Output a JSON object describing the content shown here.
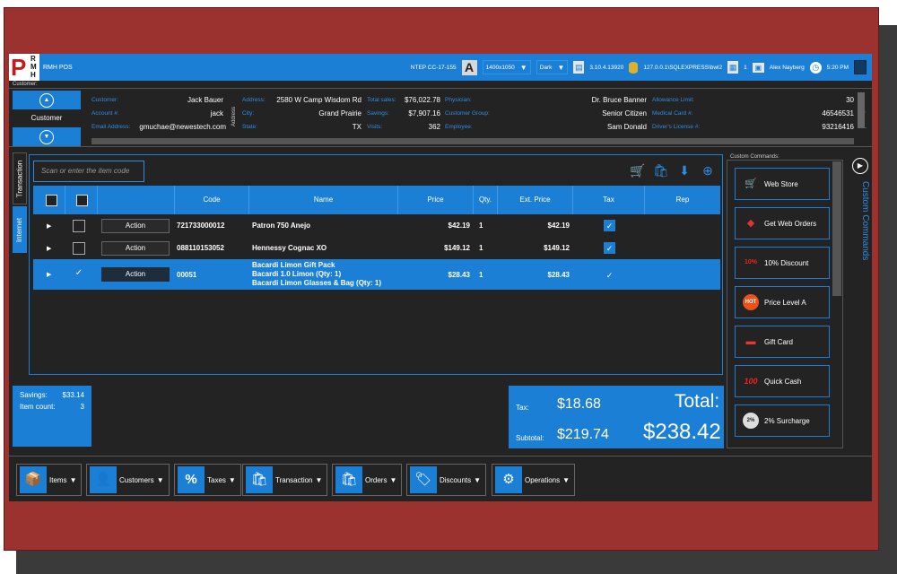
{
  "topbar": {
    "logo_letter": "P",
    "logo_lines": [
      "R",
      "M",
      "H"
    ],
    "app_name": "RMH POS",
    "station": "NTEP CC-17-155",
    "font_icon": "A",
    "resolution": "1400x1050",
    "theme": "Dark",
    "version": "3.10.4.13920",
    "server": "127.0.0.1\\SQLEXPRESS\\bwl2",
    "count": "1",
    "user": "Alex Nayberg",
    "time": "5:20 PM",
    "accent": "#1c7fd6"
  },
  "customer": {
    "section_label": "Customer:",
    "nav_label": "Customer",
    "address_vertical": "Address",
    "fields": [
      {
        "label": "Customer:",
        "value": "Jack Bauer"
      },
      {
        "label": "Account #:",
        "value": "jack"
      },
      {
        "label": "Email Address:",
        "value": "gmuchae@newestech.com"
      },
      {
        "label": "Address:",
        "value": "2580 W Camp Wisdom Rd"
      },
      {
        "label": "City:",
        "value": "Grand Prairie"
      },
      {
        "label": "State:",
        "value": "TX"
      },
      {
        "label": "Total sales:",
        "value": "$76,022.78"
      },
      {
        "label": "Savings:",
        "value": "$7,907.16"
      },
      {
        "label": "Visits:",
        "value": "362"
      },
      {
        "label": "Physician:",
        "value": "Dr. Bruce Banner"
      },
      {
        "label": "Customer Group:",
        "value": "Senior Citizen"
      },
      {
        "label": "Employee:",
        "value": "Sam Donald"
      },
      {
        "label": "Allowance Limit:",
        "value": "30"
      },
      {
        "label": "Medical Card #:",
        "value": "46546531"
      },
      {
        "label": "Driver's License #:",
        "value": "93216416"
      }
    ],
    "cut_labels": [
      "M",
      "Or",
      "DL"
    ]
  },
  "tabs": {
    "transaction": "Transaction",
    "internet": "Internet"
  },
  "transaction": {
    "scan_placeholder": "Scan or enter the item code",
    "columns": [
      "Code",
      "Name",
      "Price",
      "Qty.",
      "Ext. Price",
      "Tax",
      "Rep"
    ],
    "action_label": "Action",
    "rows": [
      {
        "code": "721733000012",
        "name": "Patron 750 Anejo",
        "sub1": "",
        "sub2": "",
        "price": "$42.19",
        "qty": "1",
        "ext": "$42.19",
        "checked": false,
        "selected": false
      },
      {
        "code": "088110153052",
        "name": "Hennessy Cognac XO",
        "sub1": "",
        "sub2": "",
        "price": "$149.12",
        "qty": "1",
        "ext": "$149.12",
        "checked": false,
        "selected": false
      },
      {
        "code": "00051",
        "name": "Bacardi Limon Gift Pack",
        "sub1": "Bacardi 1.0 Limon (Qty: 1)",
        "sub2": "Bacardi Limon Glasses & Bag (Qty: 1)",
        "price": "$28.43",
        "qty": "1",
        "ext": "$28.43",
        "checked": true,
        "selected": true
      }
    ]
  },
  "summary": {
    "savings_label": "Savings:",
    "savings_value": "$33.14",
    "item_count_label": "Item count:",
    "item_count_value": "3"
  },
  "totals": {
    "tax_label": "Tax:",
    "tax_value": "$18.68",
    "subtotal_label": "Subtotal:",
    "subtotal_value": "$219.74",
    "total_label": "Total:",
    "total_value": "$238.42"
  },
  "custom_commands": {
    "section_label": "Custom Commands:",
    "vertical_title": "Custom Commands",
    "items": [
      {
        "label": "Web Store",
        "icon": "cart-icon",
        "glyph": "🛒",
        "color": "#2d8de4"
      },
      {
        "label": "Get Web Orders",
        "icon": "web-orders-icon",
        "glyph": "◆",
        "color": "#d33"
      },
      {
        "label": "10% Discount",
        "icon": "discount-icon",
        "glyph": "10%",
        "color": "#e22"
      },
      {
        "label": "Price Level A",
        "icon": "hot-icon",
        "glyph": "HOT",
        "color": "#e8531c"
      },
      {
        "label": "Gift Card",
        "icon": "gift-card-icon",
        "glyph": "▬",
        "color": "#e33"
      },
      {
        "label": "Quick Cash",
        "icon": "cash-icon",
        "glyph": "100",
        "color": "#e22"
      },
      {
        "label": "2% Surcharge",
        "icon": "surcharge-icon",
        "glyph": "2%",
        "color": "#ddd"
      }
    ]
  },
  "bottom": {
    "buttons": [
      {
        "label": "Items",
        "icon": "items-icon",
        "glyph": "📦"
      },
      {
        "label": "Customers",
        "icon": "customers-icon",
        "glyph": "👤"
      },
      {
        "label": "Taxes",
        "icon": "taxes-icon",
        "glyph": "%"
      },
      {
        "label": "Transaction",
        "icon": "transaction-icon",
        "glyph": "🛍"
      },
      {
        "label": "Orders",
        "icon": "orders-icon",
        "glyph": "🛍"
      },
      {
        "label": "Discounts",
        "icon": "discounts-icon",
        "glyph": "🏷"
      },
      {
        "label": "Operations",
        "icon": "operations-icon",
        "glyph": "⚙"
      }
    ]
  }
}
